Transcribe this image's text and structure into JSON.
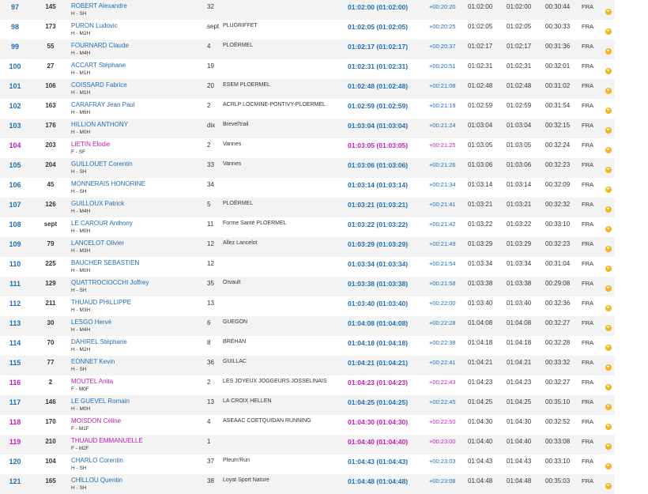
{
  "colors": {
    "male": "#1f6db5",
    "female": "#c41ab8",
    "star": "#f2b51d",
    "stripe": "#f3f3f3"
  },
  "icons": {
    "row_action": "plus-circle-icon"
  },
  "rows": [
    {
      "rank": "97",
      "bib": "145",
      "name": "ROBERT Alexandre",
      "cat": "H - SH",
      "age": "32",
      "club": "",
      "time": "01:02:00 (01:02:00)",
      "gap": "+00:20:20",
      "t1": "01:02:00",
      "t2": "01:02:00",
      "t3": "00:30:44",
      "nat": "FRA",
      "sex": "M"
    },
    {
      "rank": "98",
      "bib": "173",
      "name": "PURON Ludovic",
      "cat": "H - M2H",
      "age": "sept",
      "club": "PLUGRIFFET",
      "time": "01:02:05 (01:02:05)",
      "gap": "+00:20:25",
      "t1": "01:02:05",
      "t2": "01:02:05",
      "t3": "00:30:33",
      "nat": "FRA",
      "sex": "M"
    },
    {
      "rank": "99",
      "bib": "55",
      "name": "FOURNARD Claude",
      "cat": "H - M4H",
      "age": "4",
      "club": "PLOËRMEL",
      "time": "01:02:17 (01:02:17)",
      "gap": "+00:20:37",
      "t1": "01:02:17",
      "t2": "01:02:17",
      "t3": "00:31:36",
      "nat": "FRA",
      "sex": "M"
    },
    {
      "rank": "100",
      "bib": "27",
      "name": "ACCART Stéphane",
      "cat": "H - M1H",
      "age": "19",
      "club": "",
      "time": "01:02:31 (01:02:31)",
      "gap": "+00:20:51",
      "t1": "01:02:31",
      "t2": "01:02:31",
      "t3": "00:32:01",
      "nat": "FRA",
      "sex": "M"
    },
    {
      "rank": "101",
      "bib": "106",
      "name": "COISSARD Fabrice",
      "cat": "H - M1H",
      "age": "20",
      "club": "ESEM PLOERMEL",
      "time": "01:02:48 (01:02:48)",
      "gap": "+00:21:08",
      "t1": "01:02:48",
      "t2": "01:02:48",
      "t3": "00:31:02",
      "nat": "FRA",
      "sex": "M"
    },
    {
      "rank": "102",
      "bib": "163",
      "name": "CARAFRAY Jean Paul",
      "cat": "H - M6H",
      "age": "2",
      "club": "ACRLP LOCMINE-PONTIVY-PLOERMEL",
      "time": "01:02:59 (01:02:59)",
      "gap": "+00:21:19",
      "t1": "01:02:59",
      "t2": "01:02:59",
      "t3": "00:31:54",
      "nat": "FRA",
      "sex": "M"
    },
    {
      "rank": "103",
      "bib": "176",
      "name": "HILLION ANTHONY",
      "cat": "H - M0H",
      "age": "dix",
      "club": "Brevel'trail",
      "time": "01:03:04 (01:03:04)",
      "gap": "+00:21:24",
      "t1": "01:03:04",
      "t2": "01:03:04",
      "t3": "00:32:15",
      "nat": "FRA",
      "sex": "M"
    },
    {
      "rank": "104",
      "bib": "203",
      "name": "LIETIN Elodie",
      "cat": "F - SF",
      "age": "2",
      "club": "Vannes",
      "time": "01:03:05 (01:03:05)",
      "gap": "+00:21:25",
      "t1": "01:03:05",
      "t2": "01:03:05",
      "t3": "00:32:24",
      "nat": "FRA",
      "sex": "F"
    },
    {
      "rank": "105",
      "bib": "204",
      "name": "GUILLOUET Corentin",
      "cat": "H - SH",
      "age": "33",
      "club": "Vannes",
      "time": "01:03:06 (01:03:06)",
      "gap": "+00:21:26",
      "t1": "01:03:06",
      "t2": "01:03:06",
      "t3": "00:32:23",
      "nat": "FRA",
      "sex": "M"
    },
    {
      "rank": "106",
      "bib": "45",
      "name": "MONNERAIS HONORINE",
      "cat": "H - SH",
      "age": "34",
      "club": "",
      "time": "01:03:14 (01:03:14)",
      "gap": "+00:21:34",
      "t1": "01:03:14",
      "t2": "01:03:14",
      "t3": "00:32:09",
      "nat": "FRA",
      "sex": "M"
    },
    {
      "rank": "107",
      "bib": "126",
      "name": "GUILLOUX Patrick",
      "cat": "H - M4H",
      "age": "5",
      "club": "PLOËRMEL",
      "time": "01:03:21 (01:03:21)",
      "gap": "+00:21:41",
      "t1": "01:03:21",
      "t2": "01:03:21",
      "t3": "00:32:32",
      "nat": "FRA",
      "sex": "M"
    },
    {
      "rank": "108",
      "bib": "sept",
      "name": "LE CAROUR Anthony",
      "cat": "H - M0H",
      "age": "11",
      "club": "Forme Santé PLOERMEL",
      "time": "01:03:22 (01:03:22)",
      "gap": "+00:21:42",
      "t1": "01:03:22",
      "t2": "01:03:22",
      "t3": "00:33:10",
      "nat": "FRA",
      "sex": "M"
    },
    {
      "rank": "109",
      "bib": "79",
      "name": "LANCELOT Olivier",
      "cat": "H - M3H",
      "age": "12",
      "club": "Allez Lancelot",
      "time": "01:03:29 (01:03:29)",
      "gap": "+00:21:49",
      "t1": "01:03:29",
      "t2": "01:03:29",
      "t3": "00:32:23",
      "nat": "FRA",
      "sex": "M"
    },
    {
      "rank": "110",
      "bib": "225",
      "name": "BAUCHER SEBASTIEN",
      "cat": "H - M0H",
      "age": "12",
      "club": "",
      "time": "01:03:34 (01:03:34)",
      "gap": "+00:21:54",
      "t1": "01:03:34",
      "t2": "01:03:34",
      "t3": "00:31:04",
      "nat": "FRA",
      "sex": "M"
    },
    {
      "rank": "111",
      "bib": "129",
      "name": "QUATTROCIOCCHI Joffrey",
      "cat": "H - SH",
      "age": "35",
      "club": "Orvault",
      "time": "01:03:38 (01:03:38)",
      "gap": "+00:21:58",
      "t1": "01:03:38",
      "t2": "01:03:38",
      "t3": "00:29:08",
      "nat": "FRA",
      "sex": "M"
    },
    {
      "rank": "112",
      "bib": "211",
      "name": "THUAUD PHILLIPPE",
      "cat": "H - M3H",
      "age": "13",
      "club": "",
      "time": "01:03:40 (01:03:40)",
      "gap": "+00:22:00",
      "t1": "01:03:40",
      "t2": "01:03:40",
      "t3": "00:32:36",
      "nat": "FRA",
      "sex": "M"
    },
    {
      "rank": "113",
      "bib": "30",
      "name": "LESGO Hervé",
      "cat": "H - M4H",
      "age": "6",
      "club": "GUEGON",
      "time": "01:04:08 (01:04:08)",
      "gap": "+00:22:28",
      "t1": "01:04:08",
      "t2": "01:04:08",
      "t3": "00:32:27",
      "nat": "FRA",
      "sex": "M"
    },
    {
      "rank": "114",
      "bib": "70",
      "name": "DAHIREL Stéphane",
      "cat": "H - M2H",
      "age": "8",
      "club": "BRÉHAN",
      "time": "01:04:18 (01:04:18)",
      "gap": "+00:22:38",
      "t1": "01:04:18",
      "t2": "01:04:18",
      "t3": "00:32:28",
      "nat": "FRA",
      "sex": "M"
    },
    {
      "rank": "115",
      "bib": "77",
      "name": "EONNET Kevin",
      "cat": "H - SH",
      "age": "36",
      "club": "GUILLAC",
      "time": "01:04:21 (01:04:21)",
      "gap": "+00:22:41",
      "t1": "01:04:21",
      "t2": "01:04:21",
      "t3": "00:33:32",
      "nat": "FRA",
      "sex": "M"
    },
    {
      "rank": "116",
      "bib": "2",
      "name": "MOUTEL Anita",
      "cat": "F - M0F",
      "age": "2",
      "club": "LES JOYEUX JOGGEURS JOSSELINAIS",
      "time": "01:04:23 (01:04:23)",
      "gap": "+00:22:43",
      "t1": "01:04:23",
      "t2": "01:04:23",
      "t3": "00:32:27",
      "nat": "FRA",
      "sex": "F"
    },
    {
      "rank": "117",
      "bib": "146",
      "name": "LE GUEVEL Romain",
      "cat": "H - M0H",
      "age": "13",
      "club": "LA CROIX HELLEN",
      "time": "01:04:25 (01:04:25)",
      "gap": "+00:22:45",
      "t1": "01:04:25",
      "t2": "01:04:25",
      "t3": "00:35:10",
      "nat": "FRA",
      "sex": "M"
    },
    {
      "rank": "118",
      "bib": "170",
      "name": "MOISDON Céline",
      "cat": "F - M1F",
      "age": "4",
      "club": "ASEAAC COETQUIDAN RUNNING",
      "time": "01:04:30 (01:04:30)",
      "gap": "+00:22:50",
      "t1": "01:04:30",
      "t2": "01:04:30",
      "t3": "00:32:52",
      "nat": "FRA",
      "sex": "F"
    },
    {
      "rank": "119",
      "bib": "210",
      "name": "THUAUD EMMANUELLE",
      "cat": "F - M2F",
      "age": "1",
      "club": "",
      "time": "01:04:40 (01:04:40)",
      "gap": "+00:23:00",
      "t1": "01:04:40",
      "t2": "01:04:40",
      "t3": "00:33:08",
      "nat": "FRA",
      "sex": "F"
    },
    {
      "rank": "120",
      "bib": "104",
      "name": "CHARLO Corentin",
      "cat": "H - SH",
      "age": "37",
      "club": "Pleum'Run",
      "time": "01:04:43 (01:04:43)",
      "gap": "+00:23:03",
      "t1": "01:04:43",
      "t2": "01:04:43",
      "t3": "00:33:10",
      "nat": "FRA",
      "sex": "M"
    },
    {
      "rank": "121",
      "bib": "165",
      "name": "CHILLOU Quentin",
      "cat": "H - SH",
      "age": "38",
      "club": "Loyat Sport Nature",
      "time": "01:04:48 (01:04:48)",
      "gap": "+00:23:08",
      "t1": "01:04:48",
      "t2": "01:04:48",
      "t3": "00:35:03",
      "nat": "FRA",
      "sex": "M"
    }
  ]
}
